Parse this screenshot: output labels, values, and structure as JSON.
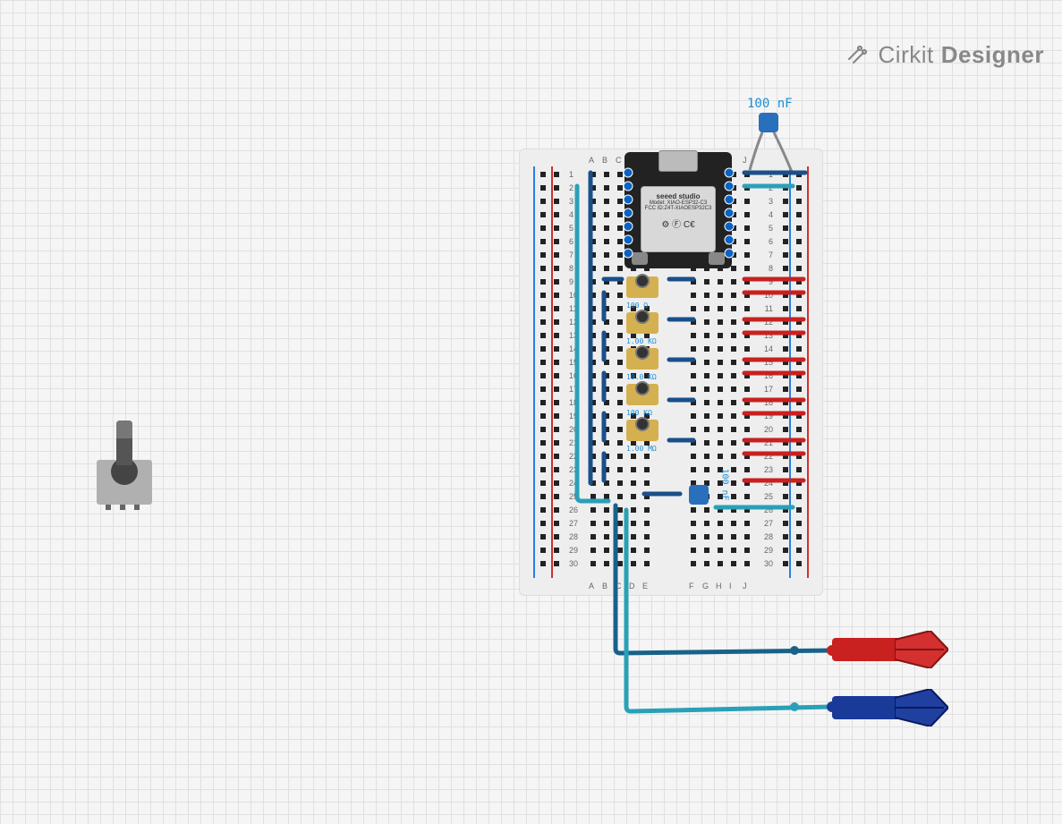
{
  "logo": {
    "brand": "Cirkit",
    "product": "Designer"
  },
  "components": {
    "capacitor_top": {
      "label": "100 nF",
      "value_nf": 100
    },
    "capacitor_bottom": {
      "label": "100 nF",
      "value_nf": 100
    },
    "mcu": {
      "line1": "seeed studio",
      "line2": "Model: XIAO-ESP32-C3",
      "line3": "FCC ID:Z4T-XIAOESP32C3",
      "pin_count_side": 7,
      "buttons": [
        "B",
        "R"
      ]
    },
    "potentiometer_standalone": {
      "type": "rotary-pot",
      "pins": 3
    },
    "trim_pots": [
      {
        "label": "100 Ω",
        "row": 9
      },
      {
        "label": "1.00 KΩ",
        "row": 12
      },
      {
        "label": "10.0 KΩ",
        "row": 15
      },
      {
        "label": "100 KΩ",
        "row": 18
      },
      {
        "label": "1.00 MΩ",
        "row": 21
      }
    ],
    "clips": [
      {
        "color": "red",
        "name": "alligator-clip-red"
      },
      {
        "color": "blue",
        "name": "alligator-clip-blue"
      }
    ],
    "breadboard": {
      "rows": 30,
      "columns_left": [
        "A",
        "B",
        "C",
        "D",
        "E"
      ],
      "columns_right": [
        "F",
        "G",
        "H",
        "I",
        "J"
      ],
      "row_labels": [
        "1",
        "2",
        "3",
        "4",
        "5",
        "6",
        "7",
        "8",
        "9",
        "10",
        "11",
        "12",
        "13",
        "14",
        "15",
        "16",
        "17",
        "18",
        "19",
        "20",
        "21",
        "22",
        "23",
        "24",
        "25",
        "26",
        "27",
        "28",
        "29",
        "30"
      ]
    }
  },
  "wires": {
    "colors": {
      "power_red": "#c92020",
      "ground_blue": "#1a4f8a",
      "signal_teal": "#2aa0b8",
      "signal_blue": "#1a6fc8"
    }
  }
}
